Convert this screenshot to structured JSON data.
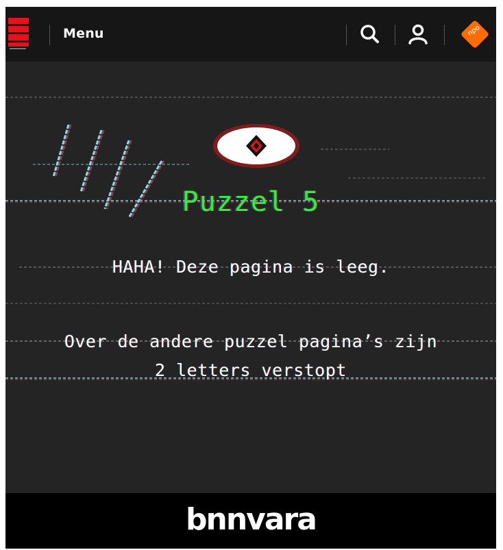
{
  "header": {
    "menu_label": "Menu",
    "icons": {
      "logo": "bnnvara-logo-icon",
      "search": "search-icon",
      "account": "user-icon",
      "npo": "npo-logo-icon"
    },
    "npo_text": "npo"
  },
  "main": {
    "title": "Puzzel 5",
    "message_line": "HAHA! Deze pagina is leeg.",
    "hint_line_1": "Over de andere puzzel pagina’s zijn",
    "hint_line_2": "2 letters verstopt"
  },
  "footer": {
    "brand": "bnnvara"
  },
  "colors": {
    "background": "#242424",
    "header": "#161616",
    "title_green": "#2ff03a",
    "logo_red": "#e1141e",
    "npo_orange": "#ff6d00"
  }
}
